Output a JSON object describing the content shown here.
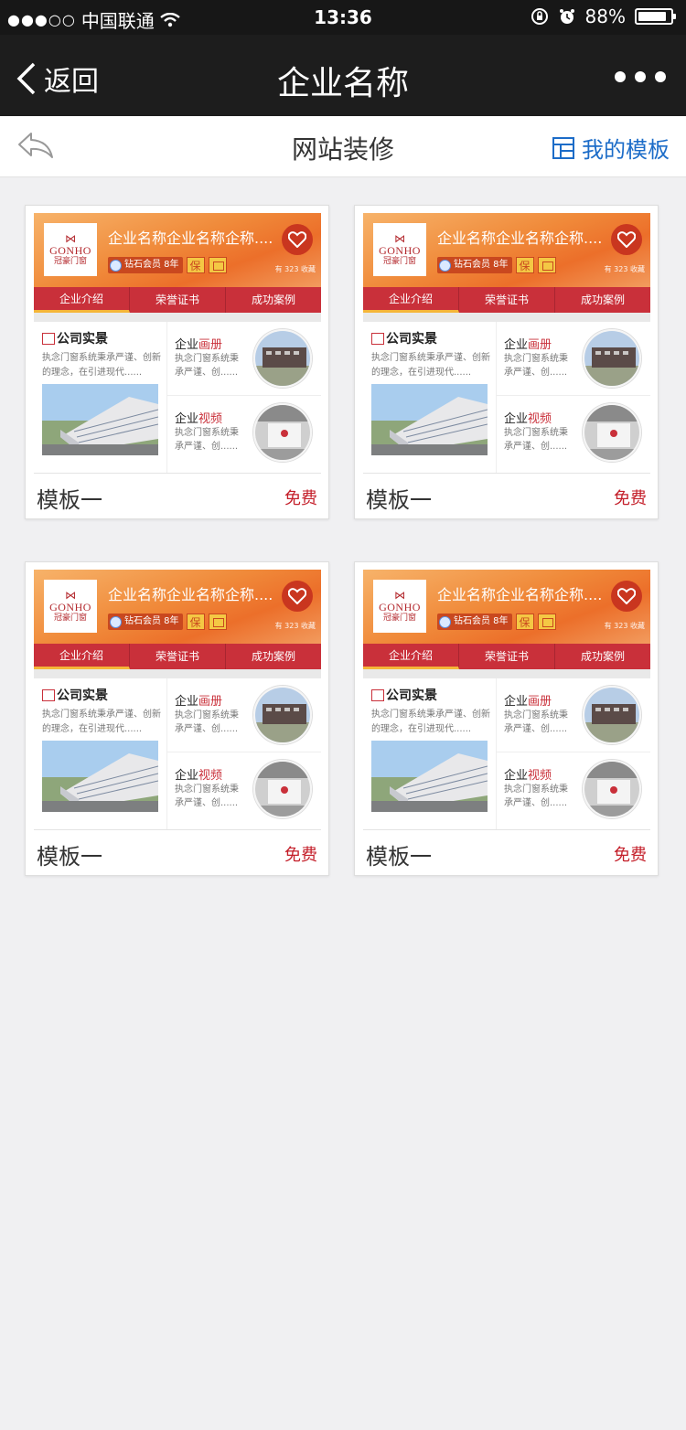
{
  "status_bar": {
    "carrier": "中国联通",
    "time": "13:36",
    "battery": "88%",
    "battery_level": 0.88
  },
  "nav": {
    "back_label": "返回",
    "title": "企业名称"
  },
  "toolbar": {
    "title": "网站装修",
    "my_templates": "我的模板"
  },
  "preview": {
    "company_name": "企业名称企业名称企称....",
    "logo_en": "GONHO",
    "logo_cn": "冠豪门窗",
    "member": "钻石会员 8年",
    "guarantee": "保",
    "favorites": "有 323 收藏",
    "tabs": [
      "企业介绍",
      "荣誉证书",
      "成功案例"
    ],
    "section1_title": "公司实景",
    "section1_desc": "执念门窗系统秉承严谨、创新的理念，在引进现代......",
    "section2_title_a": "企业",
    "section2_title_b": "画册",
    "section2_desc": "执念门窗系统秉承严谨、创......",
    "section3_title_a": "企业",
    "section3_title_b": "视频",
    "section3_desc": "执念门窗系统秉承严谨、创......"
  },
  "templates": [
    {
      "name": "模板一",
      "price": "免费"
    },
    {
      "name": "模板一",
      "price": "免费"
    },
    {
      "name": "模板一",
      "price": "免费"
    },
    {
      "name": "模板一",
      "price": "免费"
    }
  ],
  "colors": {
    "accent_red": "#c9303a",
    "link_blue": "#1c6cc8",
    "price_red": "#c41f2a"
  }
}
